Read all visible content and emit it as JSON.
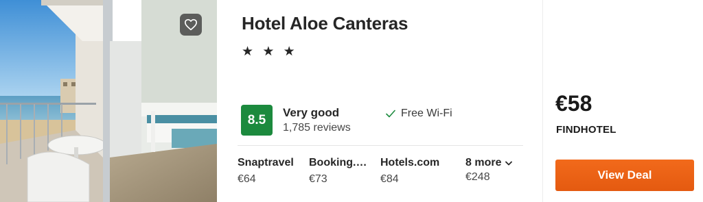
{
  "hotel": {
    "name": "Hotel Aloe Canteras",
    "stars": 3,
    "star_glyph": "★"
  },
  "rating": {
    "score": "8.5",
    "label": "Very good",
    "reviews": "1,785 reviews",
    "color": "#1c8a3e"
  },
  "amenity": {
    "icon": "checkmark-icon",
    "label": "Free Wi-Fi"
  },
  "providers": [
    {
      "name": "Snaptravel",
      "price": "€64"
    },
    {
      "name": "Booking.…",
      "price": "€73"
    },
    {
      "name": "Hotels.com",
      "price": "€84"
    }
  ],
  "more_providers": {
    "label": "8 more",
    "price": "€248",
    "icon": "chevron-down-icon"
  },
  "deal": {
    "price": "€58",
    "source": "FINDHOTEL",
    "button_label": "View Deal",
    "button_color": "#f26a1b"
  },
  "photo": {
    "icon": "heart-icon"
  }
}
